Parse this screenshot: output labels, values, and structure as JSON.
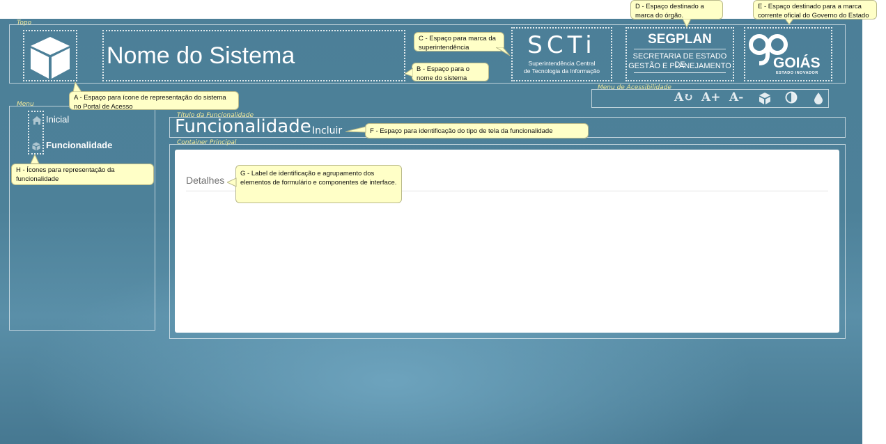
{
  "header": {
    "legend": "Topo",
    "system_name": "Nome do Sistema",
    "scti": {
      "mark": "SCTi",
      "line1": "Superintendência Central",
      "line2": "de Tecnologia da Informação"
    },
    "segplan": {
      "mark": "SEGPLAN",
      "line1": "SECRETARIA DE ESTADO DE",
      "line2": "GESTÃO E PLANEJAMENTO"
    },
    "goias": {
      "mark": "GOIÁS",
      "tagline": "ESTADO INOVADOR"
    }
  },
  "accessibility": {
    "legend": "Menu de Acessibilidade",
    "items": [
      "A↻",
      "A+",
      "A-"
    ]
  },
  "menu": {
    "legend": "Menu",
    "items": [
      {
        "label": "Inicial"
      },
      {
        "label": "Funcionalidade"
      }
    ]
  },
  "title_section": {
    "legend": "Título da Funcionalidade",
    "title": "Funcionalidade",
    "subtitle": "Incluir"
  },
  "main": {
    "legend": "Container Principal",
    "section_label": "Detalhes"
  },
  "notes": {
    "a": "A - Espaço para ícone de representação do sistema no Portal de Acesso",
    "b": "B - Espaço para o nome do sistema",
    "c": "C - Espaço para marca da superintendência",
    "d": "D - Espaço destinado a marca do órgão.",
    "e": "E - Espaço destinado para a marca corrente oficial do Governo do Estado",
    "f": "F - Espaço para identificação do tipo de tela da funcionalidade",
    "g": "G - Label de identificação e agrupamento dos elementos de formulário e componentes de interface.",
    "h": "H - Ícones para representação da funcionalidade"
  }
}
